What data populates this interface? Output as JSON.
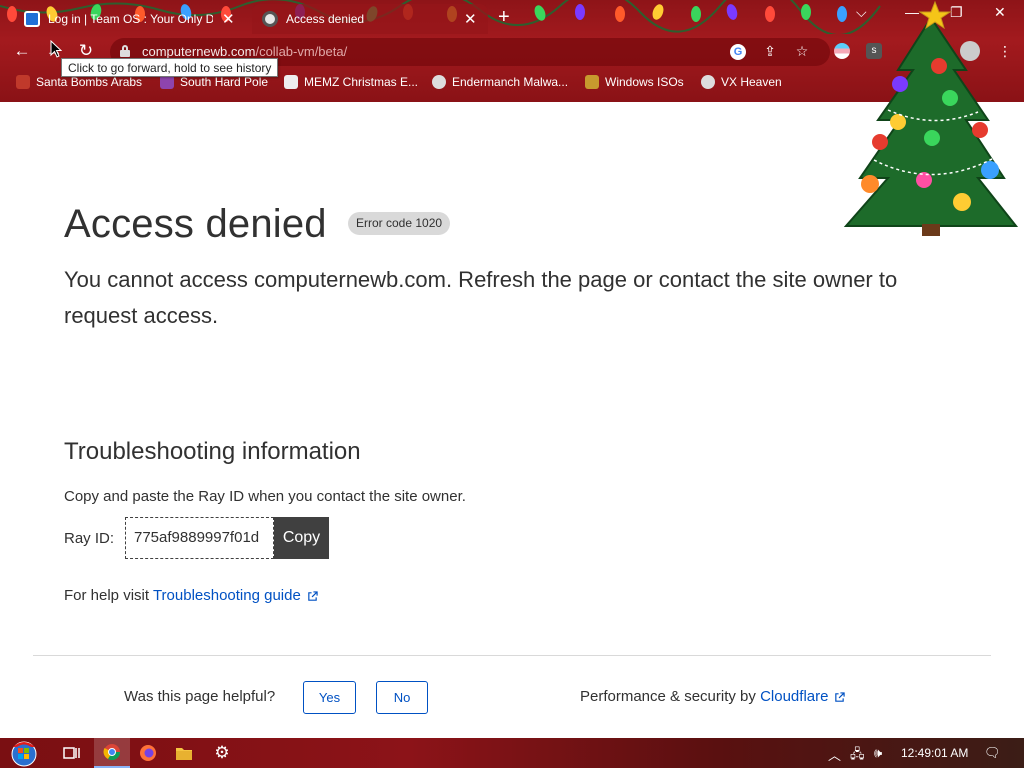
{
  "browser": {
    "tabs": [
      {
        "title": "Log in | Team OS : Your Only Des",
        "favicon": "team-os-icon",
        "active": false
      },
      {
        "title": "Access denied",
        "favicon": "cloudflare-icon",
        "active": true
      }
    ],
    "new_tab_label": "+",
    "url_host": "computernewb.com",
    "url_path": "/collab-vm/beta/",
    "tooltip": "Click to go forward, hold to see history",
    "extension_s_label": "s",
    "bookmarks": [
      {
        "label": "Santa Bombs Arabs",
        "icon": "santa-icon"
      },
      {
        "label": "South Hard Pole",
        "icon": "pole-icon"
      },
      {
        "label": "MEMZ Christmas E...",
        "icon": "memz-icon"
      },
      {
        "label": "Endermanch Malwa...",
        "icon": "endermanch-icon"
      },
      {
        "label": "Windows ISOs",
        "icon": "windows-isos-icon"
      },
      {
        "label": "VX Heaven",
        "icon": "vx-heaven-icon"
      }
    ]
  },
  "page": {
    "title": "Access denied",
    "error_badge": "Error code 1020",
    "lead": "You cannot access computernewb.com. Refresh the page or contact the site owner to request access.",
    "troubleshooting_heading": "Troubleshooting information",
    "copy_instruction": "Copy and paste the Ray ID when you contact the site owner.",
    "ray_label": "Ray ID:",
    "ray_id": "775af9889997f01d",
    "copy_button": "Copy",
    "help_prefix": "For help visit",
    "help_link": "Troubleshooting guide",
    "feedback_question": "Was this page helpful?",
    "yes_button": "Yes",
    "no_button": "No",
    "perf_prefix": "Performance & security by",
    "perf_link": "Cloudflare"
  },
  "taskbar": {
    "clock": "12:49:01 AM",
    "apps": [
      "start-button",
      "task-view-icon",
      "chrome-icon",
      "firefox-icon",
      "file-explorer-icon",
      "settings-icon"
    ]
  },
  "colors": {
    "link": "#0051c3",
    "text": "#313131",
    "chrome_red": "#a31a1e",
    "badge_bg": "#d9d9d9",
    "copy_bg": "#404040"
  }
}
